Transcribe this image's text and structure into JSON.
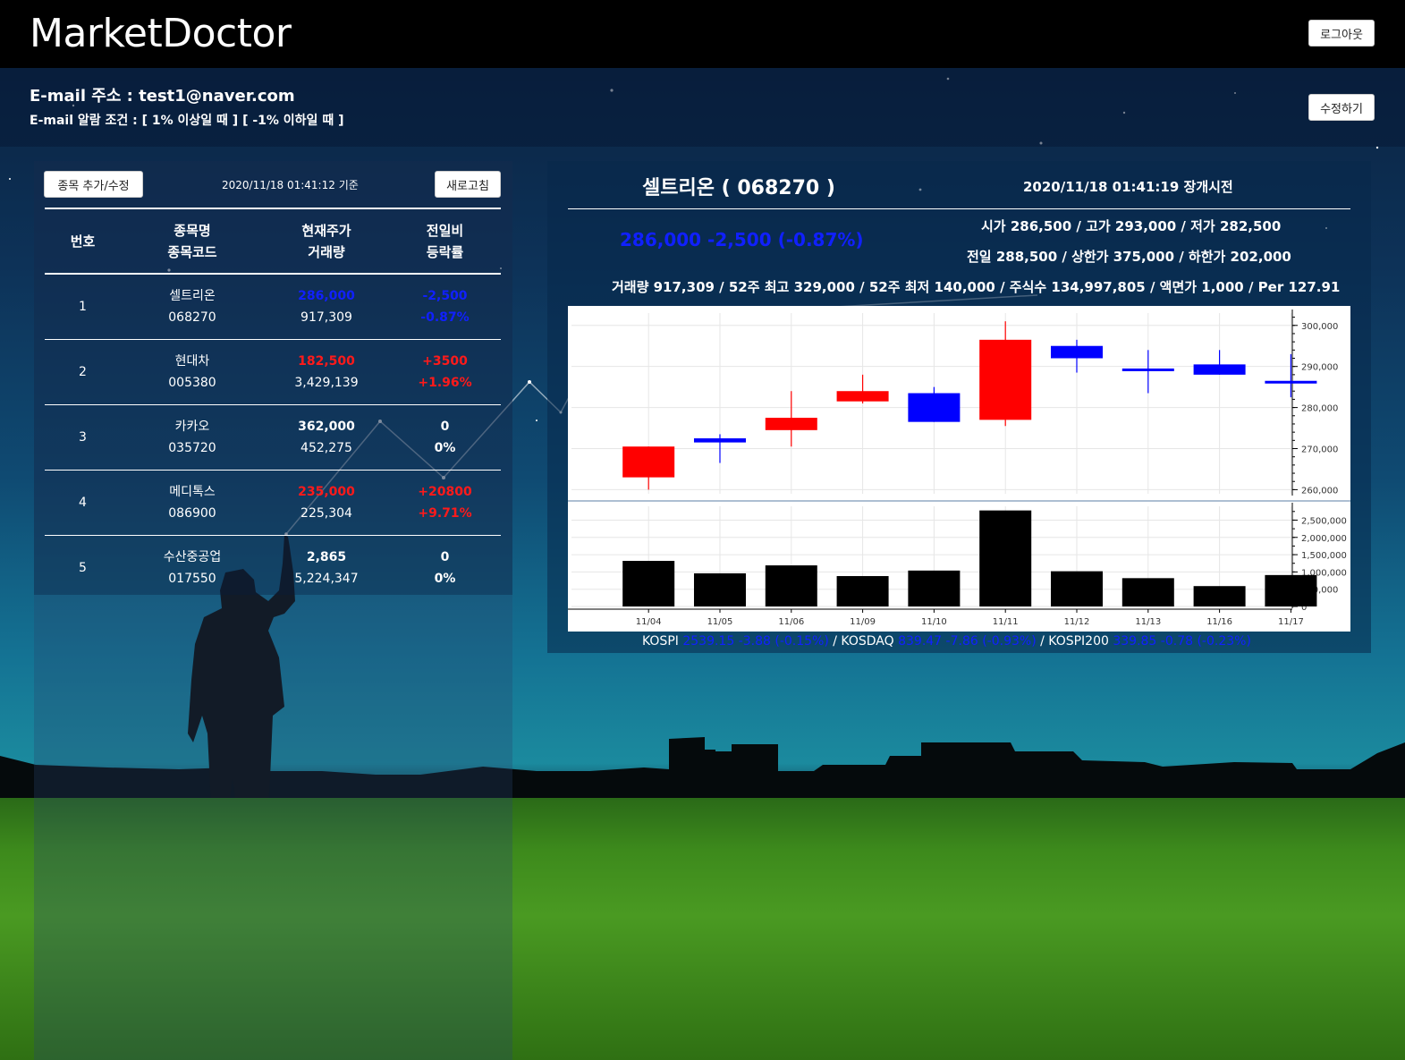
{
  "header": {
    "logo": "MarketDoctor",
    "logout_label": "로그아웃"
  },
  "account": {
    "email_label": "E-mail 주소 : ",
    "email": "test1@naver.com",
    "alarm_text": "E-mail 알람 조건 : [ 1% 이상일 때 ] [ -1% 이하일 때 ]",
    "edit_label": "수정하기"
  },
  "watchlist": {
    "add_label": "종목 추가/수정",
    "asof": "2020/11/18 01:41:12 기준",
    "refresh_label": "새로고침",
    "headers": {
      "no": "번호",
      "name": "종목명",
      "code": "종목코드",
      "price": "현재주가",
      "volume": "거래량",
      "change": "전일비",
      "rate": "등락률"
    },
    "rows": [
      {
        "no": "1",
        "name": "셀트리온",
        "code": "068270",
        "price": "286,000",
        "volume": "917,309",
        "change": "-2,500",
        "rate": "-0.87%",
        "dir": "down"
      },
      {
        "no": "2",
        "name": "현대차",
        "code": "005380",
        "price": "182,500",
        "volume": "3,429,139",
        "change": "+3500",
        "rate": "+1.96%",
        "dir": "up"
      },
      {
        "no": "3",
        "name": "카카오",
        "code": "035720",
        "price": "362,000",
        "volume": "452,275",
        "change": "0",
        "rate": "0%",
        "dir": "flat"
      },
      {
        "no": "4",
        "name": "메디톡스",
        "code": "086900",
        "price": "235,000",
        "volume": "225,304",
        "change": "+20800",
        "rate": "+9.71%",
        "dir": "up"
      },
      {
        "no": "5",
        "name": "수산중공업",
        "code": "017550",
        "price": "2,865",
        "volume": "5,224,347",
        "change": "0",
        "rate": "0%",
        "dir": "flat"
      }
    ]
  },
  "detail": {
    "title": "셀트리온 ( 068270 )",
    "time": "2020/11/18 01:41:19 장개시전",
    "price_line": "286,000 -2,500 (-0.87%)",
    "ohl": "시가 286,500 / 고가 293,000 / 저가 282,500",
    "prev": "전일 288,500 / 상한가 375,000 / 하한가 202,000",
    "stats": "거래량 917,309 / 52주 최고 329,000 / 52주 최저 140,000 / 주식수 134,997,805 / 액면가 1,000 / Per 127.91"
  },
  "indices": {
    "kospi_label": "KOSPI ",
    "kospi": "2539.15 -3.88 (-0.15%)",
    "kosdaq_label": " / KOSDAQ ",
    "kosdaq": "839.47 -7.86 (-0.93%)",
    "kospi200_label": " / KOSPI200 ",
    "kospi200": "339.85 -0.78 (-0.23%)"
  },
  "colors": {
    "up": "#ff0000",
    "down": "#0000ff",
    "header_bg": "#000000"
  },
  "chart_data": {
    "type": "candlestick",
    "categories": [
      "11/04",
      "11/05",
      "11/06",
      "11/09",
      "11/10",
      "11/11",
      "11/12",
      "11/13",
      "11/16",
      "11/17"
    ],
    "ohlc": [
      {
        "open": 263000,
        "high": 270500,
        "low": 260000,
        "close": 270500
      },
      {
        "open": 272500,
        "high": 273500,
        "low": 266500,
        "close": 271500
      },
      {
        "open": 274500,
        "high": 284000,
        "low": 270500,
        "close": 277500
      },
      {
        "open": 281500,
        "high": 288000,
        "low": 281000,
        "close": 284000
      },
      {
        "open": 283500,
        "high": 285000,
        "low": 276500,
        "close": 276500
      },
      {
        "open": 277000,
        "high": 301000,
        "low": 275500,
        "close": 296500
      },
      {
        "open": 295000,
        "high": 296500,
        "low": 288500,
        "close": 292000
      },
      {
        "open": 289500,
        "high": 294000,
        "low": 283500,
        "close": 289000
      },
      {
        "open": 290500,
        "high": 294000,
        "low": 288000,
        "close": 288000
      },
      {
        "open": 286500,
        "high": 293000,
        "low": 282500,
        "close": 286000
      }
    ],
    "volume": [
      1320000,
      960000,
      1190000,
      880000,
      1040000,
      2780000,
      1020000,
      820000,
      590000,
      910000
    ],
    "price_ticks": [
      "300,000",
      "290,000",
      "280,000",
      "270,000",
      "260,000"
    ],
    "price_tick_values": [
      300000,
      290000,
      280000,
      270000,
      260000
    ],
    "price_range": [
      259000,
      303000
    ],
    "volume_ticks": [
      "2,500,000",
      "2,000,000",
      "1,500,000",
      "1,000,000",
      "500,000",
      "0"
    ],
    "volume_tick_values": [
      2500000,
      2000000,
      1500000,
      1000000,
      500000,
      0
    ],
    "volume_range": [
      0,
      2900000
    ],
    "rising_color": "#ff0000",
    "falling_color": "#0000ff",
    "volume_color": "#000000",
    "grid": true
  }
}
